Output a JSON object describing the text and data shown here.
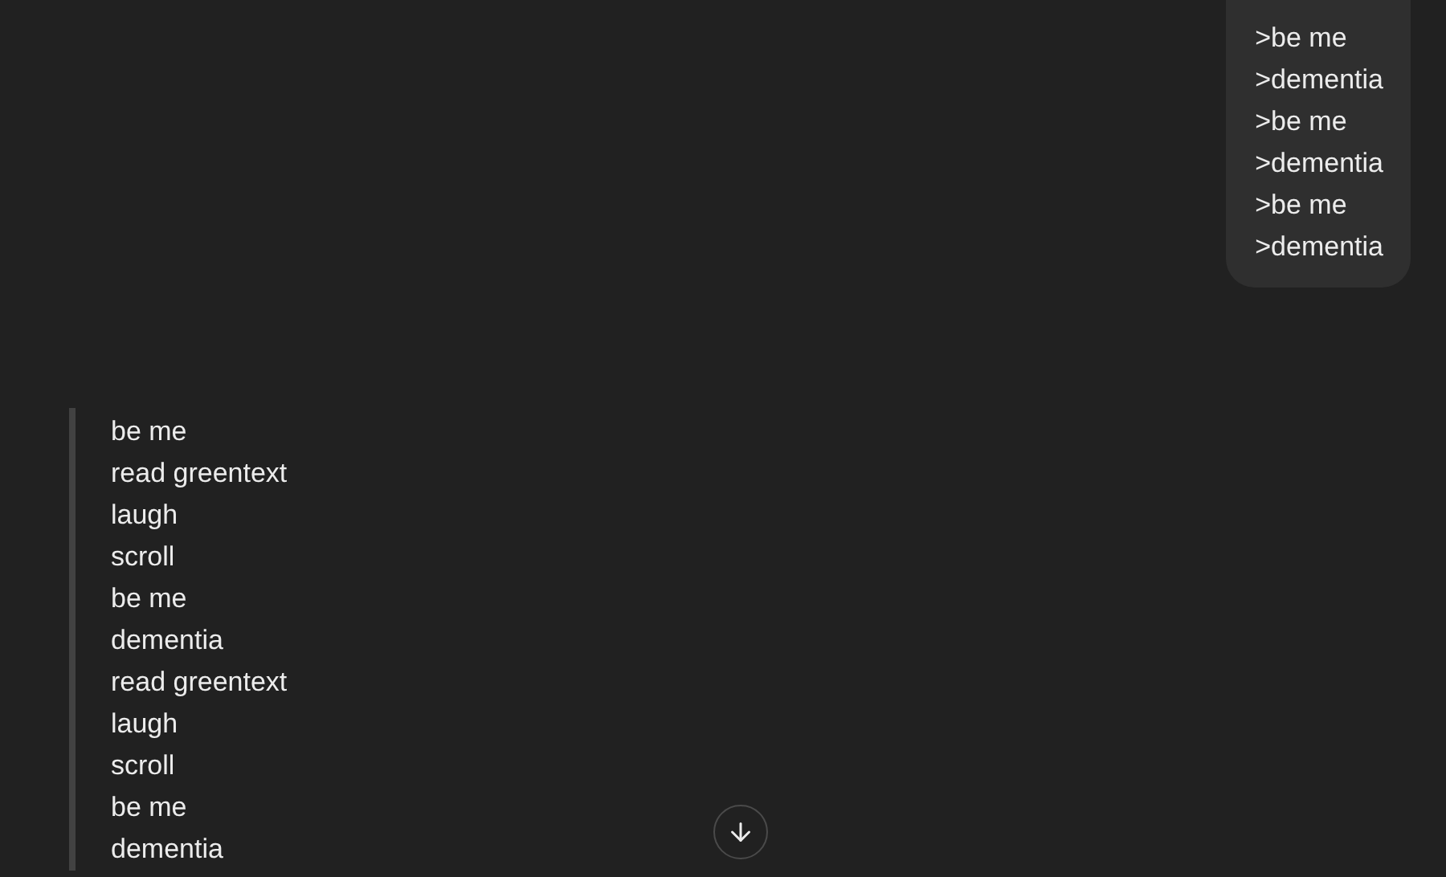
{
  "user_message": {
    "lines": [
      ">be me",
      ">dementia",
      ">be me",
      ">dementia",
      ">be me",
      ">dementia"
    ]
  },
  "response": {
    "quote_lines": [
      "be me",
      "read greentext",
      "laugh",
      "scroll",
      "be me",
      "dementia",
      "read greentext",
      "laugh",
      "scroll",
      "be me",
      "dementia"
    ]
  }
}
